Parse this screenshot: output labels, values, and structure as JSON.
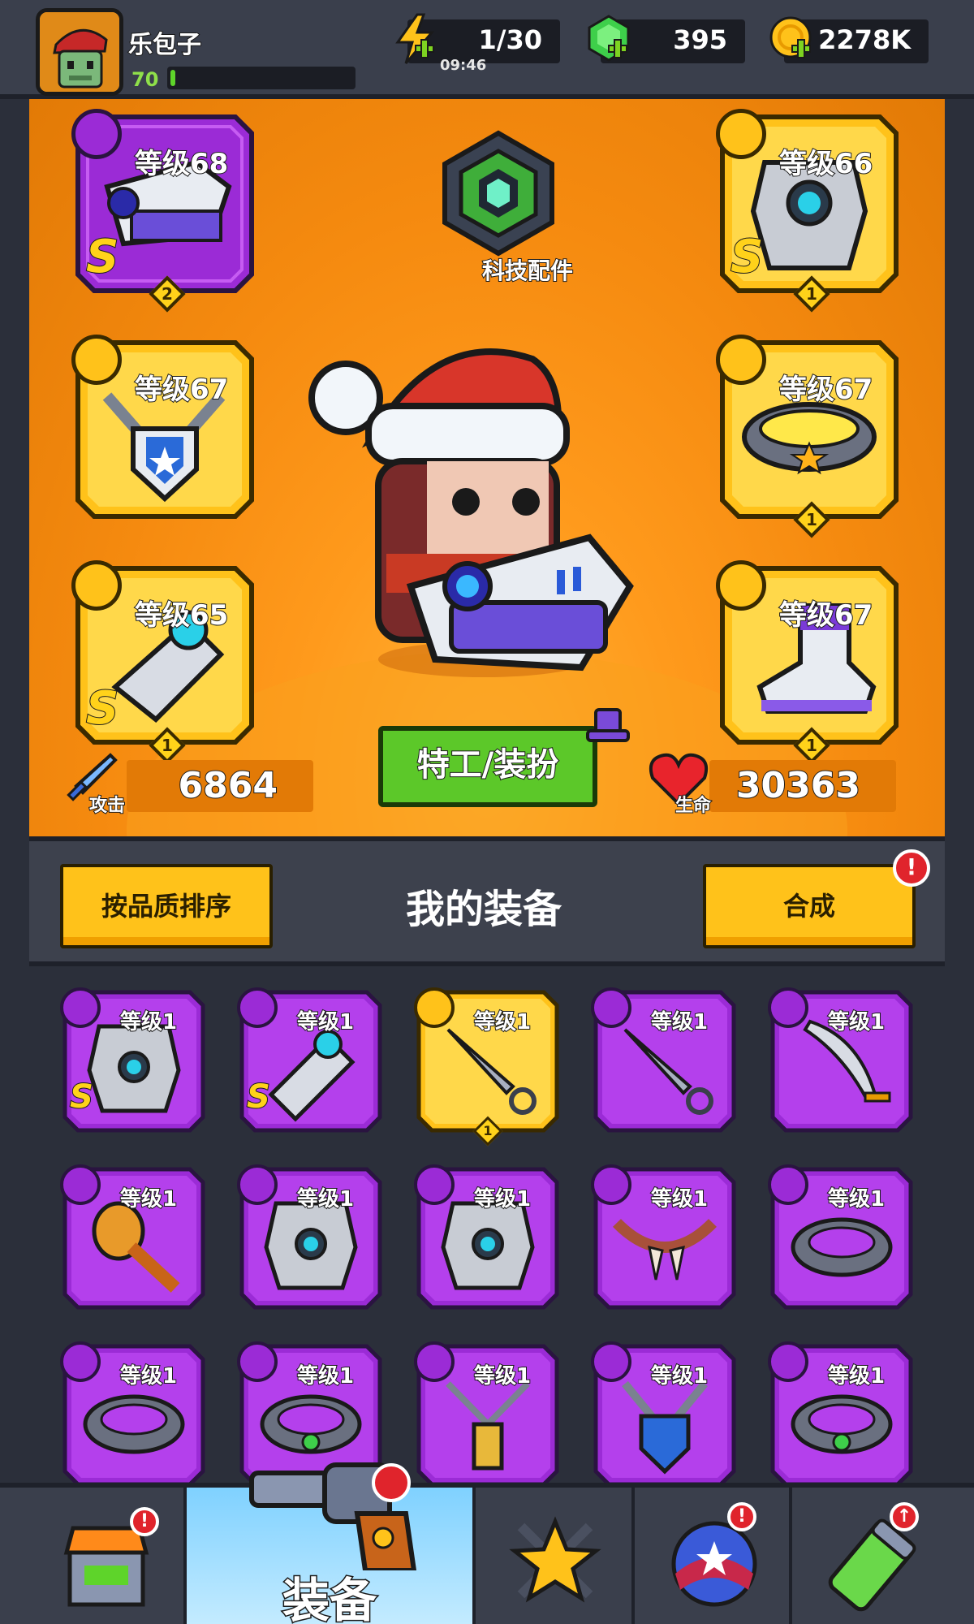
{
  "player": {
    "name": "乐包子",
    "level": "70",
    "xp_fraction": 0.02
  },
  "resources": {
    "energy": {
      "value": "1/30",
      "timer": "09:46"
    },
    "gems": {
      "value": "395"
    },
    "coins": {
      "value": "2278K"
    }
  },
  "hero": {
    "tech_label": "科技配件",
    "agent_button": "特工/装扮",
    "attack": {
      "label": "攻击",
      "value": "6864"
    },
    "health": {
      "label": "生命",
      "value": "30363"
    },
    "slots": [
      {
        "id": "weapon",
        "level": "等级68",
        "stars": "2",
        "s_badge": "S",
        "rarity": "purple"
      },
      {
        "id": "necklace",
        "level": "等级67",
        "stars": "",
        "s_badge": "",
        "rarity": "gold"
      },
      {
        "id": "gloves",
        "level": "等级65",
        "stars": "1",
        "s_badge": "S",
        "rarity": "gold"
      },
      {
        "id": "armor",
        "level": "等级66",
        "stars": "1",
        "s_badge": "S",
        "rarity": "gold"
      },
      {
        "id": "belt",
        "level": "等级67",
        "stars": "1",
        "s_badge": "",
        "rarity": "gold"
      },
      {
        "id": "boots",
        "level": "等级67",
        "stars": "1",
        "s_badge": "",
        "rarity": "gold"
      }
    ]
  },
  "equipment": {
    "title": "我的装备",
    "sort_button": "按品质排序",
    "merge_button": "合成",
    "merge_alert": "!",
    "items": [
      {
        "level": "等级1",
        "kind": "armor",
        "s_badge": "S",
        "rarity": "purple"
      },
      {
        "level": "等级1",
        "kind": "gloves",
        "s_badge": "S",
        "rarity": "purple"
      },
      {
        "level": "等级1",
        "kind": "kunai",
        "s_badge": "",
        "rarity": "gold",
        "stars": "1"
      },
      {
        "level": "等级1",
        "kind": "kunai",
        "s_badge": "",
        "rarity": "purple"
      },
      {
        "level": "等级1",
        "kind": "blade",
        "s_badge": "",
        "rarity": "purple"
      },
      {
        "level": "等级1",
        "kind": "mic-club",
        "s_badge": "",
        "rarity": "purple"
      },
      {
        "level": "等级1",
        "kind": "vest",
        "s_badge": "",
        "rarity": "purple"
      },
      {
        "level": "等级1",
        "kind": "knight-armor",
        "s_badge": "",
        "rarity": "purple"
      },
      {
        "level": "等级1",
        "kind": "fang-necklace",
        "s_badge": "",
        "rarity": "purple"
      },
      {
        "level": "等级1",
        "kind": "spiked-collar",
        "s_badge": "",
        "rarity": "purple"
      },
      {
        "level": "等级1",
        "kind": "spiked-collar",
        "s_badge": "",
        "rarity": "purple"
      },
      {
        "level": "等级1",
        "kind": "gem-ring",
        "s_badge": "",
        "rarity": "purple"
      },
      {
        "level": "等级1",
        "kind": "battery-pendant",
        "s_badge": "",
        "rarity": "purple"
      },
      {
        "level": "等级1",
        "kind": "shield-pendant",
        "s_badge": "",
        "rarity": "purple"
      },
      {
        "level": "等级1",
        "kind": "gem-belt",
        "s_badge": "",
        "rarity": "purple"
      }
    ]
  },
  "nav": {
    "active_label": "装备",
    "alert": "!"
  },
  "colors": {
    "purple_card": "#9b2bd6",
    "gold_card": "#ffc21a",
    "orange_bg": "#f58a0f",
    "green_button": "#5cc829"
  }
}
